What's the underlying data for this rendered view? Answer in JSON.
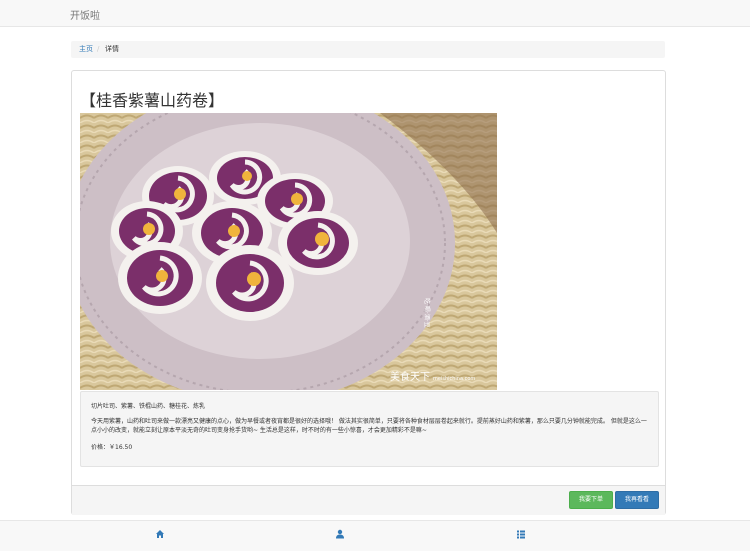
{
  "app": {
    "brand": "开饭啦"
  },
  "breadcrumb": {
    "home": "主页",
    "separator": "/",
    "current": "详情"
  },
  "dish": {
    "title": "【桂香紫薯山药卷】",
    "image_icon": "dish-photo",
    "watermark": "美食天下",
    "watermark_url": "meishichina.com",
    "side_text": "吃·喝·酒·豆",
    "ingredients": "切片吐司、紫薯、铁棍山药、糖桂花、炼乳",
    "description": "今天用紫薯，山药和吐司来做一款漂亮又健康的点心，做为早餐或者夜宵都是很好的选择哦！ 做法其实很简单，只要将各种食材层层卷起来就行。提前蒸好山药和紫薯，那么只要几分钟就能完成。 但就是这么一点小小的改变，就能立刻让原本平淡无奇的吐司变身抢手货哟~ 生活总是这样，时不时的有一些小惊喜，才会更加精彩不是嘛~",
    "price": "价格：￥16.50"
  },
  "actions": {
    "order": "我要下单",
    "more": "我再看看"
  },
  "bottom_nav": [
    {
      "icon": "home-icon"
    },
    {
      "icon": "user-icon"
    },
    {
      "icon": "list-icon"
    }
  ],
  "colors": {
    "link": "#337ab7",
    "success": "#5cb85c",
    "primary": "#337ab7"
  }
}
